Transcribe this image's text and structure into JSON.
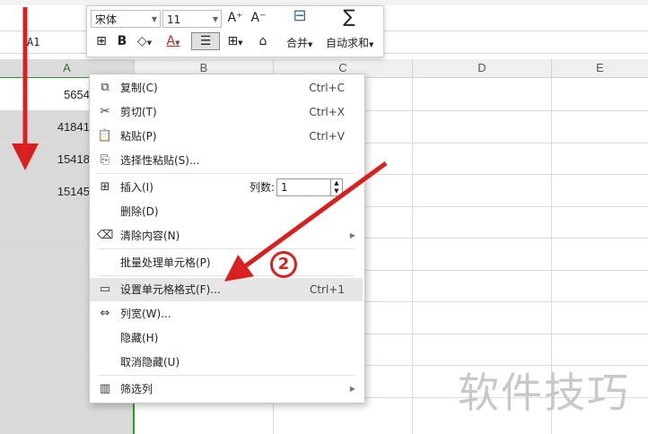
{
  "name_box": "A1",
  "column_headers": [
    "A",
    "B",
    "C",
    "D",
    "E"
  ],
  "cells": [
    "5654",
    "41841",
    "15418",
    "15145"
  ],
  "mini_toolbar": {
    "font_name": "宋体",
    "font_size": "11",
    "grow_font": "A⁺",
    "shrink_font": "A⁻",
    "bold": "B",
    "font_color_letter": "A",
    "merge_label": "合并",
    "autosum_label": "自动求和",
    "autosum_symbol": "∑"
  },
  "context_menu": {
    "items": [
      {
        "label": "复制(C)",
        "shortcut": "Ctrl+C"
      },
      {
        "label": "剪切(T)",
        "shortcut": "Ctrl+X"
      },
      {
        "label": "粘贴(P)",
        "shortcut": "Ctrl+V"
      },
      {
        "label": "选择性粘贴(S)...",
        "shortcut": ""
      },
      {
        "label": "插入(I)",
        "shortcut": ""
      },
      {
        "label": "删除(D)",
        "shortcut": ""
      },
      {
        "label": "清除内容(N)",
        "shortcut": ""
      },
      {
        "label": "批量处理单元格(P)",
        "shortcut": ""
      },
      {
        "label": "设置单元格格式(F)...",
        "shortcut": "Ctrl+1"
      },
      {
        "label": "列宽(W)...",
        "shortcut": ""
      },
      {
        "label": "隐藏(H)",
        "shortcut": ""
      },
      {
        "label": "取消隐藏(U)",
        "shortcut": ""
      },
      {
        "label": "筛选列",
        "shortcut": ""
      }
    ],
    "column_count_label": "列数:",
    "column_count_value": "1"
  },
  "annotation_step": "2",
  "watermark": "软件技巧",
  "colors": {
    "accent_green": "#2a9a2a",
    "annotation_red": "#d82020",
    "highlight": "#e6e6e6"
  }
}
